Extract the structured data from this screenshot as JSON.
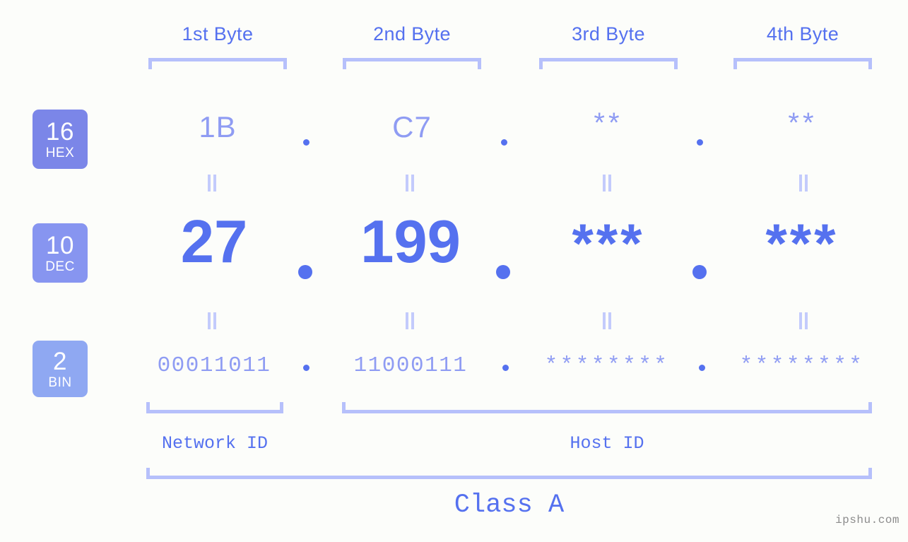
{
  "byte_headers": [
    {
      "label": "1st Byte"
    },
    {
      "label": "2nd Byte"
    },
    {
      "label": "3rd Byte"
    },
    {
      "label": "4th Byte"
    }
  ],
  "bases": [
    {
      "num": "16",
      "name": "HEX",
      "color": "#7b86e8"
    },
    {
      "num": "10",
      "name": "DEC",
      "color": "#8795f0"
    },
    {
      "num": "2",
      "name": "BIN",
      "color": "#8fa8f2"
    }
  ],
  "rows": {
    "hex": {
      "values": [
        "1B",
        "C7",
        "**",
        "**"
      ]
    },
    "dec": {
      "values": [
        "27",
        "199",
        "***",
        "***"
      ]
    },
    "bin": {
      "values": [
        "00011011",
        "11000111",
        "********",
        "********"
      ]
    }
  },
  "separator": ".",
  "equals_mark": "=",
  "segments": {
    "network_id": "Network ID",
    "host_id": "Host ID",
    "ip_class": "Class A"
  },
  "watermark": "ipshu.com",
  "colors": {
    "background": "#fcfdfa",
    "accent_strong": "#5571ef",
    "accent_light": "#8f9cf3",
    "bracket": "#b6c0fb",
    "equals": "#c3cbfc",
    "watermark": "#8c8c8c"
  }
}
